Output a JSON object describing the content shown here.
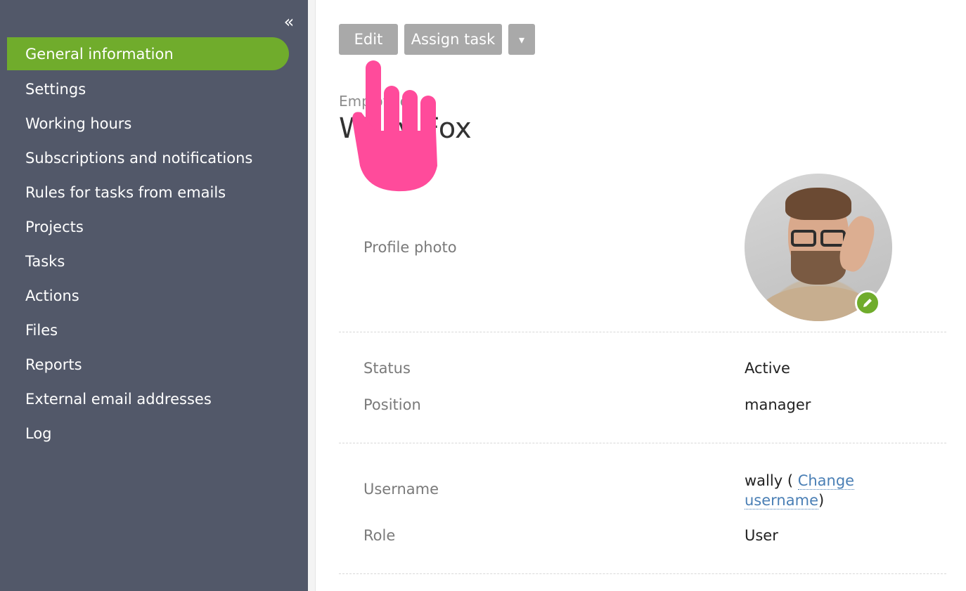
{
  "sidebar": {
    "collapse_icon": "double-chevron-left-icon",
    "items": [
      {
        "label": "General information",
        "active": true
      },
      {
        "label": "Settings"
      },
      {
        "label": "Working hours"
      },
      {
        "label": "Subscriptions and notifications"
      },
      {
        "label": "Rules for tasks from emails"
      },
      {
        "label": "Projects"
      },
      {
        "label": "Tasks"
      },
      {
        "label": "Actions"
      },
      {
        "label": "Files"
      },
      {
        "label": "Reports"
      },
      {
        "label": "External email addresses"
      },
      {
        "label": "Log"
      }
    ]
  },
  "toolbar": {
    "edit_label": "Edit",
    "assign_label": "Assign task",
    "more_label": "▾"
  },
  "header": {
    "type": "Employee",
    "name": "Wally Fox"
  },
  "details": {
    "profile_photo_label": "Profile photo",
    "status_label": "Status",
    "status_value": "Active",
    "position_label": "Position",
    "position_value": "manager",
    "username_label": "Username",
    "username_value": "wally",
    "change_username_link": "Change username",
    "role_label": "Role",
    "role_value": "User"
  },
  "colors": {
    "sidebar_bg": "#525869",
    "accent": "#70ac2c",
    "button_bg": "#a9a9a9",
    "link": "#4a7fb5",
    "pointer": "#ff4b9b"
  }
}
